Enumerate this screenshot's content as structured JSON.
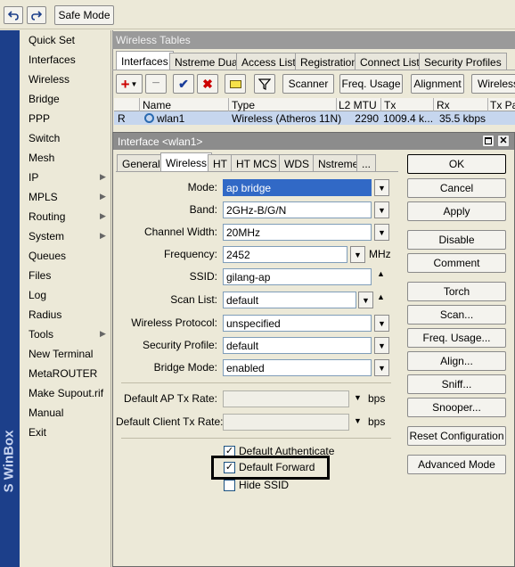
{
  "toolbar": {
    "undo_icon": "undo-icon",
    "redo_icon": "redo-icon",
    "safe_mode": "Safe Mode"
  },
  "brand": "S WinBox",
  "sidebar": {
    "items": [
      {
        "label": "Quick Set",
        "arrow": false
      },
      {
        "label": "Interfaces",
        "arrow": false
      },
      {
        "label": "Wireless",
        "arrow": false
      },
      {
        "label": "Bridge",
        "arrow": false
      },
      {
        "label": "PPP",
        "arrow": false
      },
      {
        "label": "Switch",
        "arrow": false
      },
      {
        "label": "Mesh",
        "arrow": false
      },
      {
        "label": "IP",
        "arrow": true
      },
      {
        "label": "MPLS",
        "arrow": true
      },
      {
        "label": "Routing",
        "arrow": true
      },
      {
        "label": "System",
        "arrow": true
      },
      {
        "label": "Queues",
        "arrow": false
      },
      {
        "label": "Files",
        "arrow": false
      },
      {
        "label": "Log",
        "arrow": false
      },
      {
        "label": "Radius",
        "arrow": false
      },
      {
        "label": "Tools",
        "arrow": true
      },
      {
        "label": "New Terminal",
        "arrow": false
      },
      {
        "label": "MetaROUTER",
        "arrow": false
      },
      {
        "label": "Make Supout.rif",
        "arrow": false
      },
      {
        "label": "Manual",
        "arrow": false
      },
      {
        "label": "Exit",
        "arrow": false
      }
    ]
  },
  "wireless_tables": {
    "title": "Wireless Tables",
    "tabs": [
      "Interfaces",
      "Nstreme Dual",
      "Access List",
      "Registration",
      "Connect List",
      "Security Profiles"
    ],
    "actions": {
      "scanner": "Scanner",
      "freq_usage": "Freq. Usage",
      "alignment": "Alignment",
      "wireless": "Wireless"
    },
    "columns": [
      "Name",
      "Type",
      "L2 MTU",
      "Tx",
      "Rx",
      "Tx Pa"
    ],
    "row": {
      "flag": "R",
      "name": "wlan1",
      "type": "Wireless (Atheros 11N)",
      "l2mtu": "2290",
      "tx": "1009.4 k...",
      "rx": "35.5 kbps",
      "txpa": ""
    }
  },
  "dialog": {
    "title": "Interface <wlan1>",
    "tabs": [
      "General",
      "Wireless",
      "HT",
      "HT MCS",
      "WDS",
      "Nstreme",
      "..."
    ],
    "fields": {
      "mode": {
        "label": "Mode:",
        "value": "ap bridge"
      },
      "band": {
        "label": "Band:",
        "value": "2GHz-B/G/N"
      },
      "channel_width": {
        "label": "Channel Width:",
        "value": "20MHz"
      },
      "frequency": {
        "label": "Frequency:",
        "value": "2452",
        "unit": "MHz"
      },
      "ssid": {
        "label": "SSID:",
        "value": "gilang-ap"
      },
      "scan_list": {
        "label": "Scan List:",
        "value": "default"
      },
      "wireless_protocol": {
        "label": "Wireless Protocol:",
        "value": "unspecified"
      },
      "security_profile": {
        "label": "Security Profile:",
        "value": "default"
      },
      "bridge_mode": {
        "label": "Bridge Mode:",
        "value": "enabled"
      },
      "default_ap_tx_rate": {
        "label": "Default AP Tx Rate:",
        "value": "",
        "unit": "bps"
      },
      "default_client_tx_rate": {
        "label": "Default Client Tx Rate:",
        "value": "",
        "unit": "bps"
      }
    },
    "checks": {
      "default_authenticate": {
        "label": "Default Authenticate",
        "checked": true
      },
      "default_forward": {
        "label": "Default Forward",
        "checked": true
      },
      "hide_ssid": {
        "label": "Hide SSID",
        "checked": false
      }
    },
    "buttons": [
      "OK",
      "Cancel",
      "Apply",
      "Disable",
      "Comment",
      "Torch",
      "Scan...",
      "Freq. Usage...",
      "Align...",
      "Sniff...",
      "Snooper...",
      "Reset Configuration",
      "Advanced Mode"
    ],
    "highlight_color": "#000000"
  },
  "colors": {
    "sidebar_strip": "#1c3f8a",
    "selected_field": "#3169c6",
    "title_bar": "#8c8c8c",
    "add_icon": "#cc0000",
    "check_icon": "#1a3d9a"
  }
}
